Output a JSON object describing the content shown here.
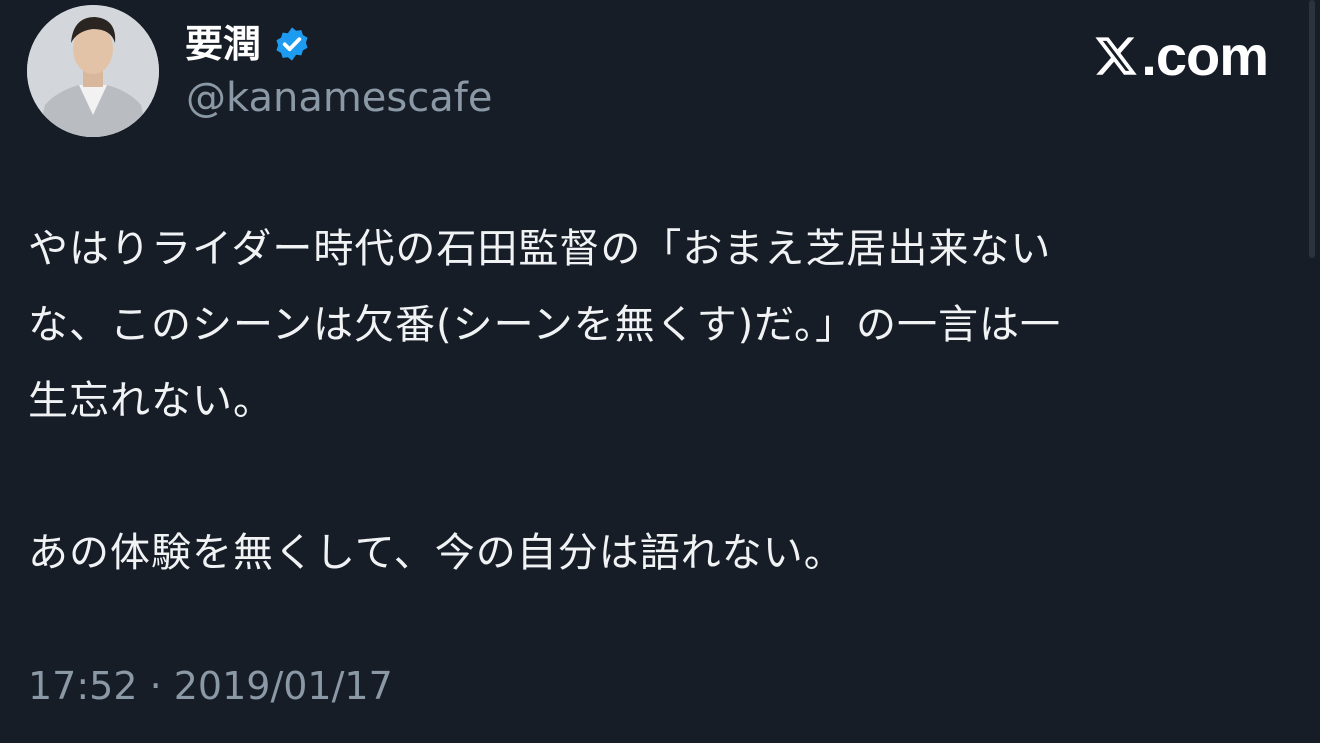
{
  "author": {
    "display_name": "要潤",
    "handle": "@kanamescafe",
    "verified_icon": "verified-badge-icon",
    "verified_color": "#1d9bf0"
  },
  "brand": {
    "logo_icon": "x-logo-icon",
    "domain": ".com"
  },
  "tweet": {
    "lines": [
      "やはりライダー時代の石田監督の「おまえ芝居出来ない",
      "な、このシーンは欠番(シーンを無くす)だ。」の一言は一",
      "生忘れない。",
      "",
      "あの体験を無くして、今の自分は語れない。"
    ],
    "timestamp": "17:52 · 2019/01/17"
  },
  "colors": {
    "background": "#161d27",
    "text": "#f0f2f4",
    "muted": "#8b98a5"
  }
}
